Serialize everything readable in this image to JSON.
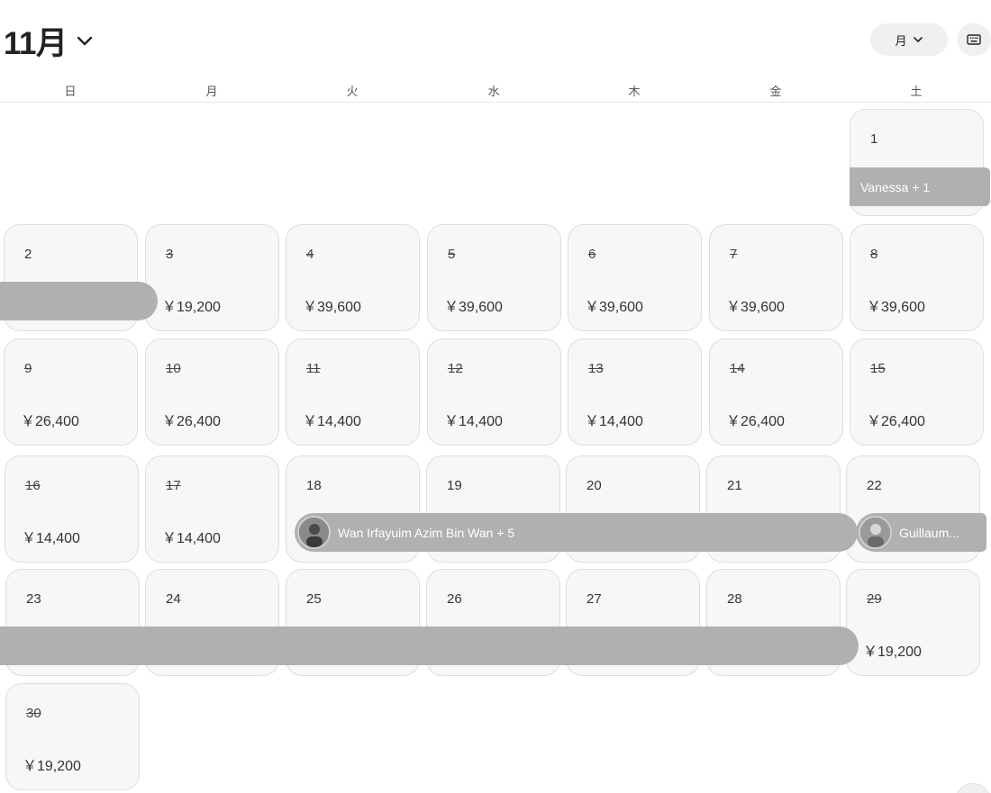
{
  "header": {
    "month": "11月",
    "view_label": "月"
  },
  "weekdays": [
    "日",
    "月",
    "火",
    "水",
    "木",
    "金",
    "土"
  ],
  "days": [
    {
      "day": "1",
      "past": false,
      "price": ""
    },
    {
      "day": "2",
      "past": false,
      "price": ""
    },
    {
      "day": "3",
      "past": true,
      "price": "￥19,200"
    },
    {
      "day": "4",
      "past": true,
      "price": "￥39,600"
    },
    {
      "day": "5",
      "past": true,
      "price": "￥39,600"
    },
    {
      "day": "6",
      "past": true,
      "price": "￥39,600"
    },
    {
      "day": "7",
      "past": true,
      "price": "￥39,600"
    },
    {
      "day": "8",
      "past": true,
      "price": "￥39,600"
    },
    {
      "day": "9",
      "past": true,
      "price": "￥26,400"
    },
    {
      "day": "10",
      "past": true,
      "price": "￥26,400"
    },
    {
      "day": "11",
      "past": true,
      "price": "￥14,400"
    },
    {
      "day": "12",
      "past": true,
      "price": "￥14,400"
    },
    {
      "day": "13",
      "past": true,
      "price": "￥14,400"
    },
    {
      "day": "14",
      "past": true,
      "price": "￥26,400"
    },
    {
      "day": "15",
      "past": true,
      "price": "￥26,400"
    },
    {
      "day": "16",
      "past": true,
      "price": "￥14,400"
    },
    {
      "day": "17",
      "past": true,
      "price": "￥14,400"
    },
    {
      "day": "18",
      "past": false,
      "price": ""
    },
    {
      "day": "19",
      "past": false,
      "price": ""
    },
    {
      "day": "20",
      "past": false,
      "price": ""
    },
    {
      "day": "21",
      "past": false,
      "price": ""
    },
    {
      "day": "22",
      "past": false,
      "price": ""
    },
    {
      "day": "23",
      "past": false,
      "price": ""
    },
    {
      "day": "24",
      "past": false,
      "price": ""
    },
    {
      "day": "25",
      "past": false,
      "price": ""
    },
    {
      "day": "26",
      "past": false,
      "price": ""
    },
    {
      "day": "27",
      "past": false,
      "price": ""
    },
    {
      "day": "28",
      "past": false,
      "price": ""
    },
    {
      "day": "29",
      "past": true,
      "price": "￥19,200"
    },
    {
      "day": "30",
      "past": true,
      "price": "￥19,200"
    }
  ],
  "reservations": [
    {
      "label": "Vanessa + 1",
      "has_avatar": false
    },
    {
      "label": "",
      "has_avatar": false
    },
    {
      "label": "Wan Irfayuim Azim Bin Wan + 5",
      "has_avatar": true
    },
    {
      "label": "Guillaum...",
      "has_avatar": true
    },
    {
      "label": "",
      "has_avatar": false
    }
  ]
}
